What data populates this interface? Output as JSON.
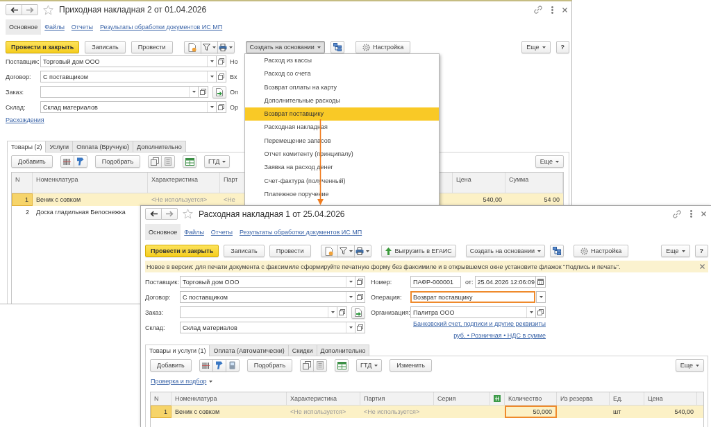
{
  "windows": [
    {
      "title": "Приходная накладная 2 от 01.04.2026",
      "nav_tabs": [
        {
          "label": "Основное",
          "selected": true
        },
        {
          "label": "Файлы",
          "selected": false
        },
        {
          "label": "Отчеты",
          "selected": false
        },
        {
          "label": "Результаты обработки документов ИС МП",
          "selected": false
        }
      ],
      "commands": [
        {
          "kind": "primary",
          "label": "Провести и закрыть"
        },
        {
          "kind": "button",
          "label": "Записать"
        },
        {
          "kind": "button",
          "label": "Провести"
        },
        {
          "kind": "icon_group",
          "buttons": [
            {
              "kind": "document"
            },
            {
              "kind": "filter_menu"
            },
            {
              "kind": "print_menu"
            }
          ]
        },
        {
          "kind": "menu_button",
          "label": "Создать на основании",
          "expanded": true,
          "menu": [
            {
              "label": "Расход из кассы",
              "selected": false
            },
            {
              "label": "Расход со счета",
              "selected": false
            },
            {
              "label": "Возврат оплаты на карту",
              "selected": false
            },
            {
              "label": "Дополнительные расходы",
              "selected": false
            },
            {
              "label": "Возврат поставщику",
              "selected": true
            },
            {
              "label": "Расходная накладная",
              "selected": false
            },
            {
              "label": "Перемещение запасов",
              "selected": false
            },
            {
              "label": "Отчет комитенту (принципалу)",
              "selected": false
            },
            {
              "label": "Заявка на расход денег",
              "selected": false
            },
            {
              "label": "Счет-фактура (полученный)",
              "selected": false
            },
            {
              "label": "Платежное поручение",
              "selected": false
            }
          ]
        },
        {
          "kind": "icon_group",
          "buttons": [
            {
              "kind": "structure"
            }
          ]
        },
        {
          "kind": "settings",
          "label": "Настройка"
        },
        {
          "kind": "more",
          "label": "Еще"
        },
        {
          "kind": "help",
          "label": "?"
        }
      ],
      "form": {
        "left": {
          "fields": [
            {
              "kind": "ref",
              "label": "Поставщик:",
              "value": "Торговый дом ООО",
              "highlighted": false
            },
            {
              "kind": "ref",
              "label": "Договор:",
              "value": "С поставщиком",
              "highlighted": false
            },
            {
              "kind": "ref_action",
              "label": "Заказ:",
              "highlighted": false
            },
            {
              "kind": "ref",
              "label": "Склад:",
              "value": "Склад материалов",
              "highlighted": false
            }
          ],
          "links": [
            "Расхождения"
          ]
        },
        "right": {
          "labels": [
            "Но",
            "Вх",
            "Оп",
            "Ор"
          ]
        }
      },
      "tabs": [
        {
          "label": "Товары (2)",
          "selected": true
        },
        {
          "label": "Услуги",
          "selected": false
        },
        {
          "label": "Оплата (Вручную)",
          "selected": false
        },
        {
          "label": "Дополнительно",
          "selected": false
        }
      ],
      "table_toolbar": [
        {
          "kind": "button",
          "label": "Добавить"
        },
        {
          "kind": "icon_group",
          "buttons": [
            {
              "kind": "barcode"
            },
            {
              "kind": "scanner"
            }
          ]
        },
        {
          "kind": "button",
          "label": "Подобрать"
        },
        {
          "kind": "icon_group",
          "buttons": [
            {
              "kind": "copy"
            },
            {
              "kind": "page"
            }
          ]
        },
        {
          "kind": "icon_group",
          "buttons": [
            {
              "kind": "sheet"
            }
          ]
        },
        {
          "kind": "menu_button",
          "label": "ГТД",
          "expanded": false
        },
        {
          "kind": "more",
          "label": "Еще"
        }
      ],
      "table": {
        "columns": [
          {
            "kind": "text",
            "label": "N"
          },
          {
            "kind": "text",
            "label": "Номенклатура"
          },
          {
            "kind": "text",
            "label": "Характеристика"
          },
          {
            "kind": "text",
            "label": "Парт"
          },
          {
            "kind": "text",
            "label": "Цена"
          },
          {
            "kind": "text",
            "label": "Сумма"
          }
        ],
        "rows": [
          {
            "selected": true,
            "cells": [
              {
                "text": "1",
                "highlighted": false
              },
              {
                "text": "Веник с совком",
                "highlighted": false
              },
              {
                "placeholder": "<Не используется>",
                "highlighted": false
              },
              {
                "placeholder": "<Не",
                "highlighted": false
              },
              {
                "text": "540,00",
                "highlighted": false
              },
              {
                "text": "54 00",
                "highlighted": false
              }
            ]
          },
          {
            "selected": false,
            "cells": [
              {
                "text": "2",
                "highlighted": false
              },
              {
                "text": "Доска гладильная Белоснежка",
                "highlighted": false
              }
            ]
          }
        ]
      }
    },
    {
      "title": "Расходная накладная 1 от 25.04.2026",
      "nav_tabs": [
        {
          "label": "Основное",
          "selected": true
        },
        {
          "label": "Файлы",
          "selected": false
        },
        {
          "label": "Отчеты",
          "selected": false
        },
        {
          "label": "Результаты обработки документов ИС МП",
          "selected": false
        }
      ],
      "commands": [
        {
          "kind": "primary",
          "label": "Провести и закрыть"
        },
        {
          "kind": "button",
          "label": "Записать"
        },
        {
          "kind": "button",
          "label": "Провести"
        },
        {
          "kind": "icon_group",
          "buttons": [
            {
              "kind": "document"
            },
            {
              "kind": "filter_menu"
            },
            {
              "kind": "print_menu"
            }
          ]
        },
        {
          "kind": "upload",
          "label": "Выгрузить в ЕГАИС"
        },
        {
          "kind": "menu_button",
          "label": "Создать на основании",
          "expanded": false
        },
        {
          "kind": "icon_group",
          "buttons": [
            {
              "kind": "structure"
            }
          ]
        },
        {
          "kind": "settings",
          "label": "Настройка"
        },
        {
          "kind": "more",
          "label": "Еще"
        },
        {
          "kind": "help",
          "label": "?"
        }
      ],
      "notice": "Новое в версии: для печати документа с факсимиле сформируйте печатную форму без факсимиле и в открывшемся окне установите флажок \"Подпись и печать\".",
      "form": {
        "left": {
          "fields": [
            {
              "kind": "ref",
              "label": "Поставщик:",
              "value": "Торговый дом ООО",
              "highlighted": false
            },
            {
              "kind": "ref",
              "label": "Договор:",
              "value": "С поставщиком",
              "highlighted": false
            },
            {
              "kind": "ref_action",
              "label": "Заказ:",
              "highlighted": false
            },
            {
              "kind": "ref",
              "label": "Склад:",
              "value": "Склад материалов",
              "highlighted": false
            }
          ]
        },
        "right": {
          "fields": [
            {
              "kind": "number_date",
              "label": "Номер:",
              "value": "ПАФР-000001",
              "date_label": "от:",
              "date": "25.04.2026 12:06:09",
              "highlighted": false
            },
            {
              "kind": "select",
              "label": "Операция:",
              "value": "Возврат поставщику",
              "highlighted": true
            },
            {
              "kind": "ref",
              "label": "Организация:",
              "value": "Палитра ООО",
              "highlighted": false
            }
          ],
          "links": [
            "Банковский счет, подписи и другие реквизиты",
            "руб. • Розничная • НДС в сумме"
          ]
        }
      },
      "tabs": [
        {
          "label": "Товары и услуги (1)",
          "selected": true
        },
        {
          "label": "Оплата (Автоматически)",
          "selected": false
        },
        {
          "label": "Скидки",
          "selected": false
        },
        {
          "label": "Дополнительно",
          "selected": false
        }
      ],
      "table_toolbar": [
        {
          "kind": "button",
          "label": "Добавить"
        },
        {
          "kind": "icon_group",
          "buttons": [
            {
              "kind": "barcode"
            },
            {
              "kind": "scanner"
            },
            {
              "kind": "handheld"
            }
          ]
        },
        {
          "kind": "button",
          "label": "Подобрать"
        },
        {
          "kind": "icon_group",
          "buttons": [
            {
              "kind": "copy"
            },
            {
              "kind": "page"
            }
          ]
        },
        {
          "kind": "icon_group",
          "buttons": [
            {
              "kind": "sheet"
            }
          ]
        },
        {
          "kind": "menu_button",
          "label": "ГТД",
          "expanded": false
        },
        {
          "kind": "button",
          "label": "Изменить"
        },
        {
          "kind": "more",
          "label": "Еще"
        }
      ],
      "check_link": "Проверка и подбор",
      "table": {
        "columns": [
          {
            "kind": "text",
            "label": "N"
          },
          {
            "kind": "text",
            "label": "Номенклатура"
          },
          {
            "kind": "text",
            "label": "Характеристика"
          },
          {
            "kind": "text",
            "label": "Партия"
          },
          {
            "kind": "text",
            "label": "Серия"
          },
          {
            "kind": "icon"
          },
          {
            "kind": "text",
            "label": "Количество"
          },
          {
            "kind": "text",
            "label": "Из резерва"
          },
          {
            "kind": "text",
            "label": "Ед."
          },
          {
            "kind": "text",
            "label": "Цена"
          }
        ],
        "rows": [
          {
            "selected": true,
            "cells": [
              {
                "text": "1",
                "highlighted": false
              },
              {
                "text": "Веник с совком",
                "highlighted": false
              },
              {
                "placeholder": "<Не используется>",
                "highlighted": false
              },
              {
                "placeholder": "<Не используется>",
                "highlighted": false
              },
              {
                "highlighted": false
              },
              {
                "highlighted": false
              },
              {
                "text": "50,000",
                "highlighted": true
              },
              {
                "highlighted": false
              },
              {
                "text": "шт",
                "highlighted": false
              },
              {
                "text": "540,00",
                "highlighted": false
              }
            ]
          }
        ]
      }
    }
  ]
}
